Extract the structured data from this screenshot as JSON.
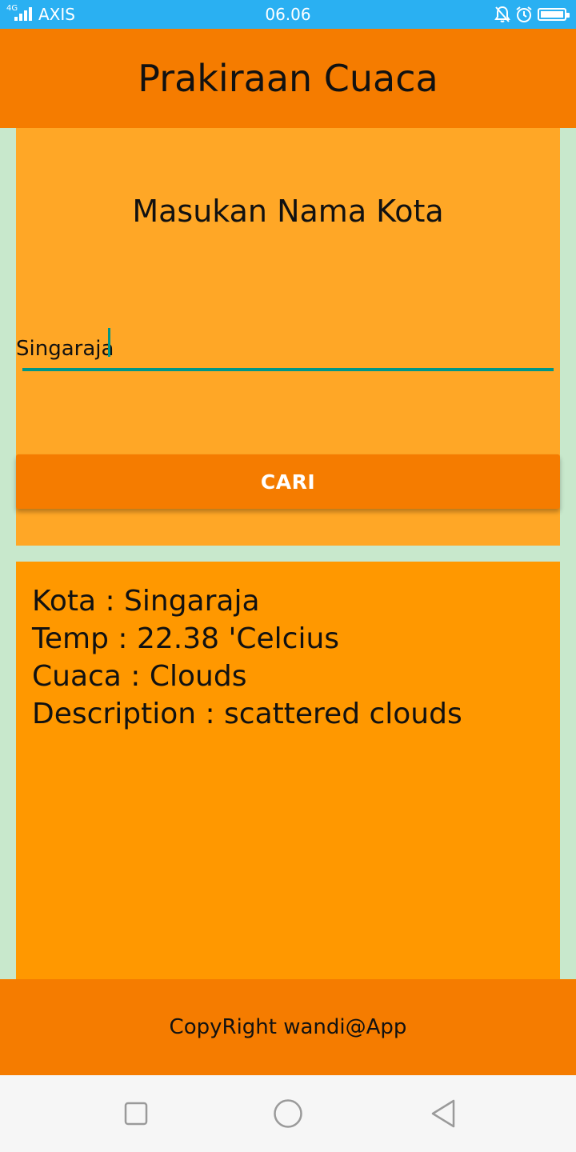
{
  "status_bar": {
    "network": "4G",
    "carrier": "AXIS",
    "time": "06.06",
    "icons": [
      "signal-icon",
      "silent-bell-icon",
      "alarm-icon",
      "battery-icon"
    ]
  },
  "app_bar": {
    "title": "Prakiraan Cuaca"
  },
  "search": {
    "prompt": "Masukan Nama Kota",
    "city_value": "Singaraja",
    "button_label": "CARI"
  },
  "result": {
    "city_line": "Kota : Singaraja",
    "temp_line": "Temp : 22.38 'Celcius",
    "weather_line": "Cuaca : Clouds",
    "description_line": "Description : scattered clouds"
  },
  "footer": {
    "text": "CopyRight wandi@App"
  },
  "nav_bar": {
    "icons": [
      "recent-apps-icon",
      "home-icon",
      "back-icon"
    ]
  },
  "colors": {
    "status_bar": "#2ab0f2",
    "app_bar": "#f57c00",
    "search_card": "#ffa726",
    "result_card": "#ff9800",
    "page_background": "#c8e8cc",
    "accent": "#009688"
  }
}
